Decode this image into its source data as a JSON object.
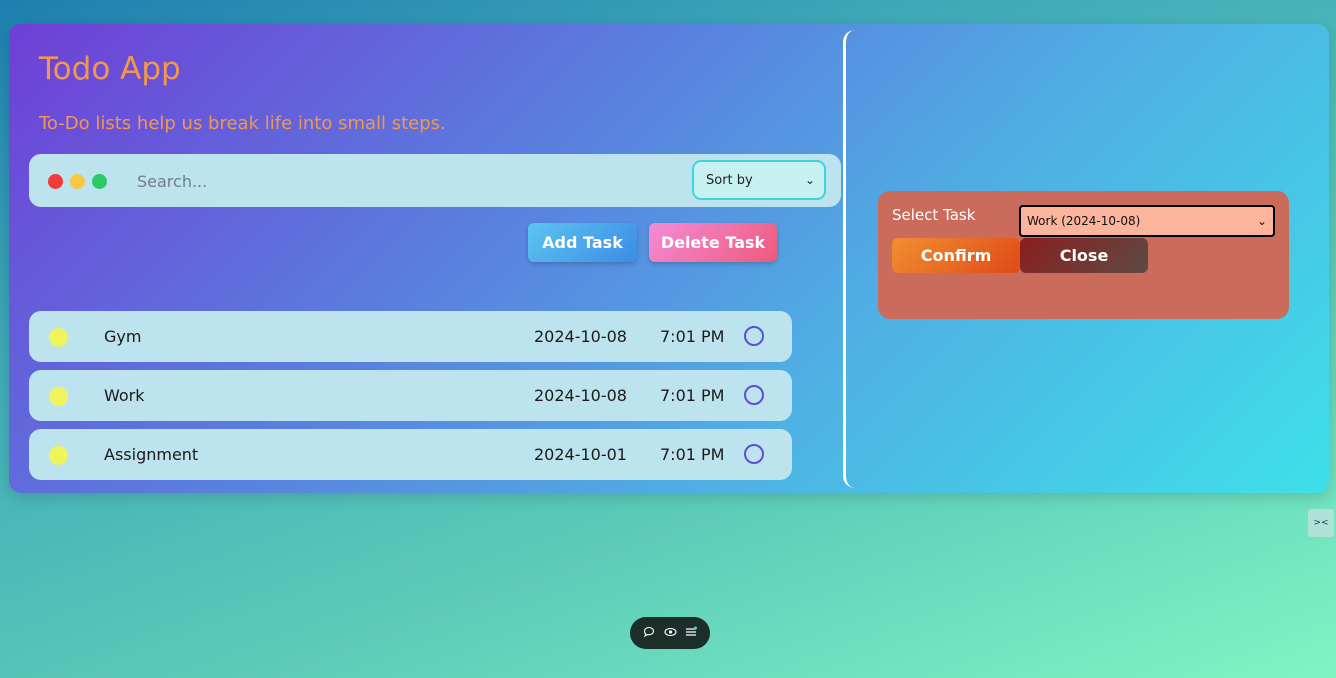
{
  "app": {
    "title": "Todo App",
    "subtitle": "To-Do lists help us break life into small steps."
  },
  "search": {
    "placeholder": "Search...",
    "sort_label": "Sort by"
  },
  "buttons": {
    "add": "Add Task",
    "delete": "Delete Task"
  },
  "tasks": [
    {
      "name": "Gym",
      "date": "2024-10-08",
      "time": "7:01 PM"
    },
    {
      "name": "Work",
      "date": "2024-10-08",
      "time": "7:01 PM"
    },
    {
      "name": "Assignment",
      "date": "2024-10-01",
      "time": "7:01 PM"
    }
  ],
  "modal": {
    "label": "Select Task",
    "selected": "Work (2024-10-08)",
    "confirm": "Confirm",
    "close": "Close"
  },
  "side_widget": {
    "icon": "><"
  },
  "bottom_bar": {
    "icons": [
      "comment-icon",
      "eye-icon",
      "menu-icon"
    ]
  },
  "colors": {
    "accent_text": "#f2984e",
    "modal_bg": "#cb6b5c",
    "task_bg": "#bde3ef"
  }
}
